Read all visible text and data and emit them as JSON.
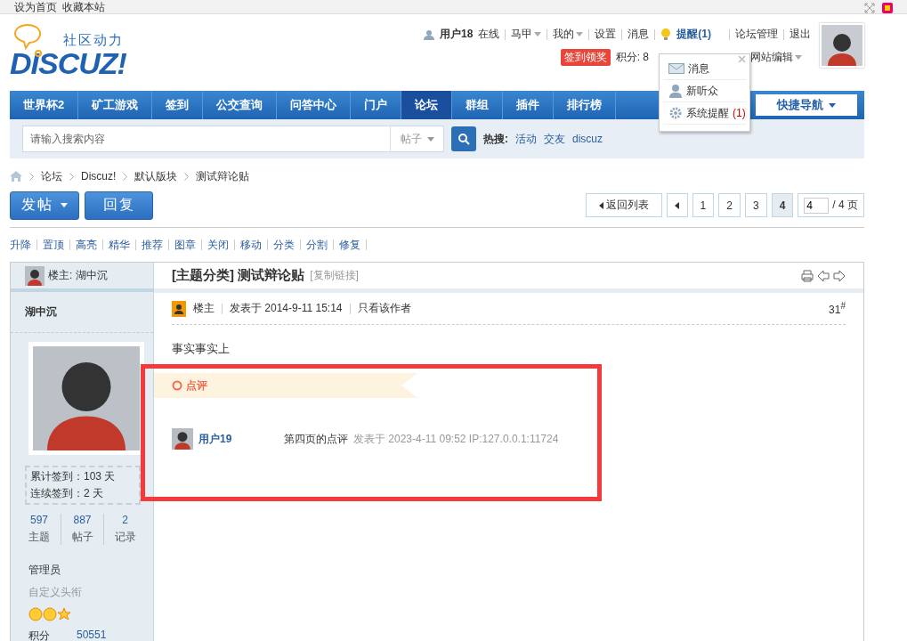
{
  "top_bar": {
    "links": [
      "设为首页",
      "收藏本站"
    ]
  },
  "logo": {
    "tagline": "社区动力",
    "wordmark": "DISCUZ!"
  },
  "user_bar": {
    "username": "用户18",
    "status": "在线",
    "links": [
      {
        "label": "马甲",
        "dropdown": true
      },
      {
        "label": "我的",
        "dropdown": true
      },
      {
        "label": "设置",
        "dropdown": false
      },
      {
        "label": "消息",
        "dropdown": false
      }
    ],
    "reminder": "提醒(1)",
    "admin_links": [
      "论坛管理",
      "退出"
    ],
    "checkin_badge": "签到领奖",
    "points": "积分: 8",
    "site_edit": "网站编辑"
  },
  "reminder_menu": {
    "items": [
      {
        "kind": "mail",
        "label": "消息"
      },
      {
        "kind": "user",
        "label": "新听众"
      },
      {
        "kind": "gear",
        "label": "系统提醒",
        "count": "(1)"
      }
    ]
  },
  "nav": {
    "items": [
      {
        "label": "世界杯2",
        "selected": false
      },
      {
        "label": "矿工游戏",
        "selected": false
      },
      {
        "label": "签到",
        "selected": false
      },
      {
        "label": "公交查询",
        "selected": false
      },
      {
        "label": "问答中心",
        "selected": false
      },
      {
        "label": "门户",
        "selected": false
      },
      {
        "label": "论坛",
        "selected": true
      },
      {
        "label": "群组",
        "selected": false
      },
      {
        "label": "插件",
        "selected": false
      },
      {
        "label": "排行榜",
        "selected": false
      }
    ],
    "quick_nav": "快捷导航"
  },
  "search": {
    "placeholder": "请输入搜索内容",
    "scope": "帖子",
    "hot_label": "热搜:",
    "hot_terms": [
      "活动",
      "交友",
      "discuz"
    ]
  },
  "breadcrumb": [
    "论坛",
    "Discuz!",
    "默认版块",
    "测试辩论贴"
  ],
  "actions": {
    "post": "发帖",
    "reply": "回复"
  },
  "pagination": {
    "back": "返回列表",
    "pages": [
      {
        "label": "1",
        "selected": false
      },
      {
        "label": "2",
        "selected": false
      },
      {
        "label": "3",
        "selected": false
      },
      {
        "label": "4",
        "selected": true
      }
    ],
    "jump_value": "4",
    "total": "/ 4 页"
  },
  "mod_actions": [
    "升降",
    "置顶",
    "高亮",
    "精华",
    "推荐",
    "图章",
    "关闭",
    "移动",
    "分类",
    "分割",
    "修复"
  ],
  "author": {
    "header": "楼主: 湖中沉",
    "name": "湖中沉",
    "checkin": [
      "累计签到：103 天",
      "连续签到：2 天"
    ],
    "stats": [
      {
        "value": "597",
        "label": "主题"
      },
      {
        "value": "887",
        "label": "帖子"
      },
      {
        "value": "2",
        "label": "记录"
      }
    ],
    "group": "管理员",
    "custom_title": "自定义头衔",
    "points_label": "积分",
    "points_value": "50551"
  },
  "thread": {
    "category": "[主题分类]",
    "title": "测试辩论贴",
    "copy_link": "[复制链接]"
  },
  "post": {
    "role": "楼主",
    "posted": "发表于 2014-9-11 15:14",
    "only_author": "只看该作者",
    "floor": "31",
    "floor_mark": "#",
    "body": "事实事实上"
  },
  "comments": {
    "header": "点评",
    "items": [
      {
        "user": "用户19",
        "text": "第四页的点评",
        "meta": "发表于 2023-4-11 09:52 IP:127.0.0.1:11724"
      }
    ]
  }
}
